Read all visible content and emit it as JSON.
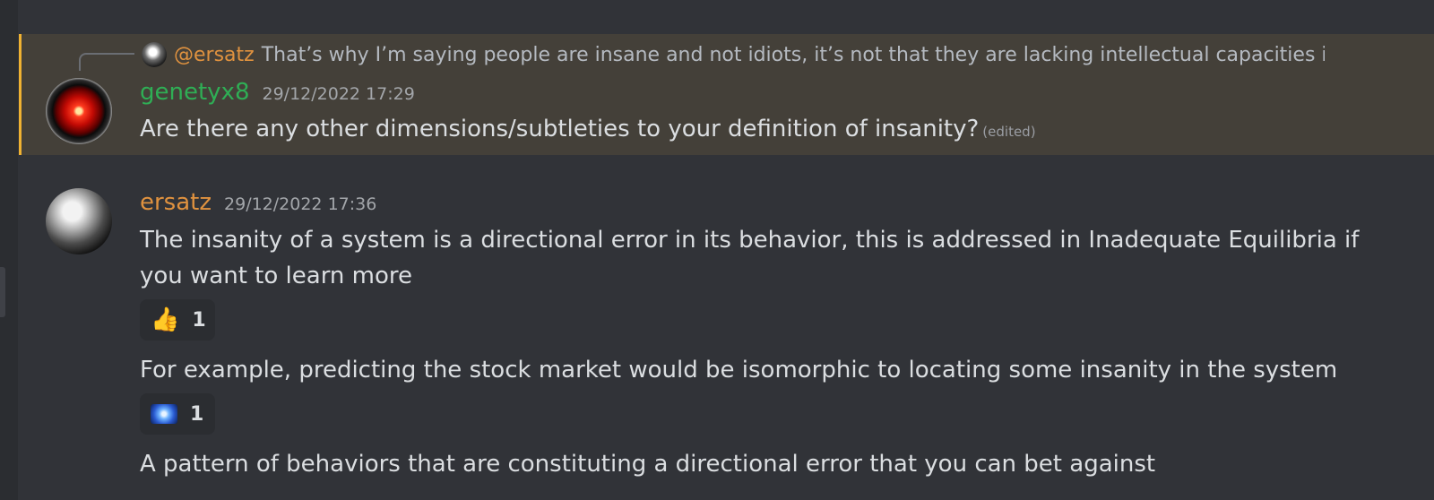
{
  "reply_preview": {
    "mention": "@ersatz",
    "text": "That’s why I’m saying people are insane and not idiots, it’s not that they are lacking intellectual capacities i"
  },
  "messages": [
    {
      "username": "genetyx8",
      "username_color": "#2fae55",
      "timestamp": "29/12/2022 17:29",
      "text": "Are there any other dimensions/subtleties to your definition of insanity?",
      "edited_label": "(edited)",
      "highlight_color": "#f0b232"
    },
    {
      "username": "ersatz",
      "username_color": "#e0923f",
      "timestamp": "29/12/2022 17:36",
      "lines": [
        "The insanity of a system is a directional error in its behavior, this is addressed in Inadequate Equilibria if",
        "you want to learn more"
      ]
    },
    {
      "text": "For example, predicting the stock market would be isomorphic to locating some insanity in the system"
    },
    {
      "text": "A pattern of behaviors that are constituting a directional error that you can bet against"
    }
  ],
  "reactions": [
    {
      "emoji": "👍",
      "icon": "thumbs-up-icon",
      "count": "1"
    },
    {
      "icon": "galaxy-emoji-icon",
      "count": "1"
    }
  ]
}
